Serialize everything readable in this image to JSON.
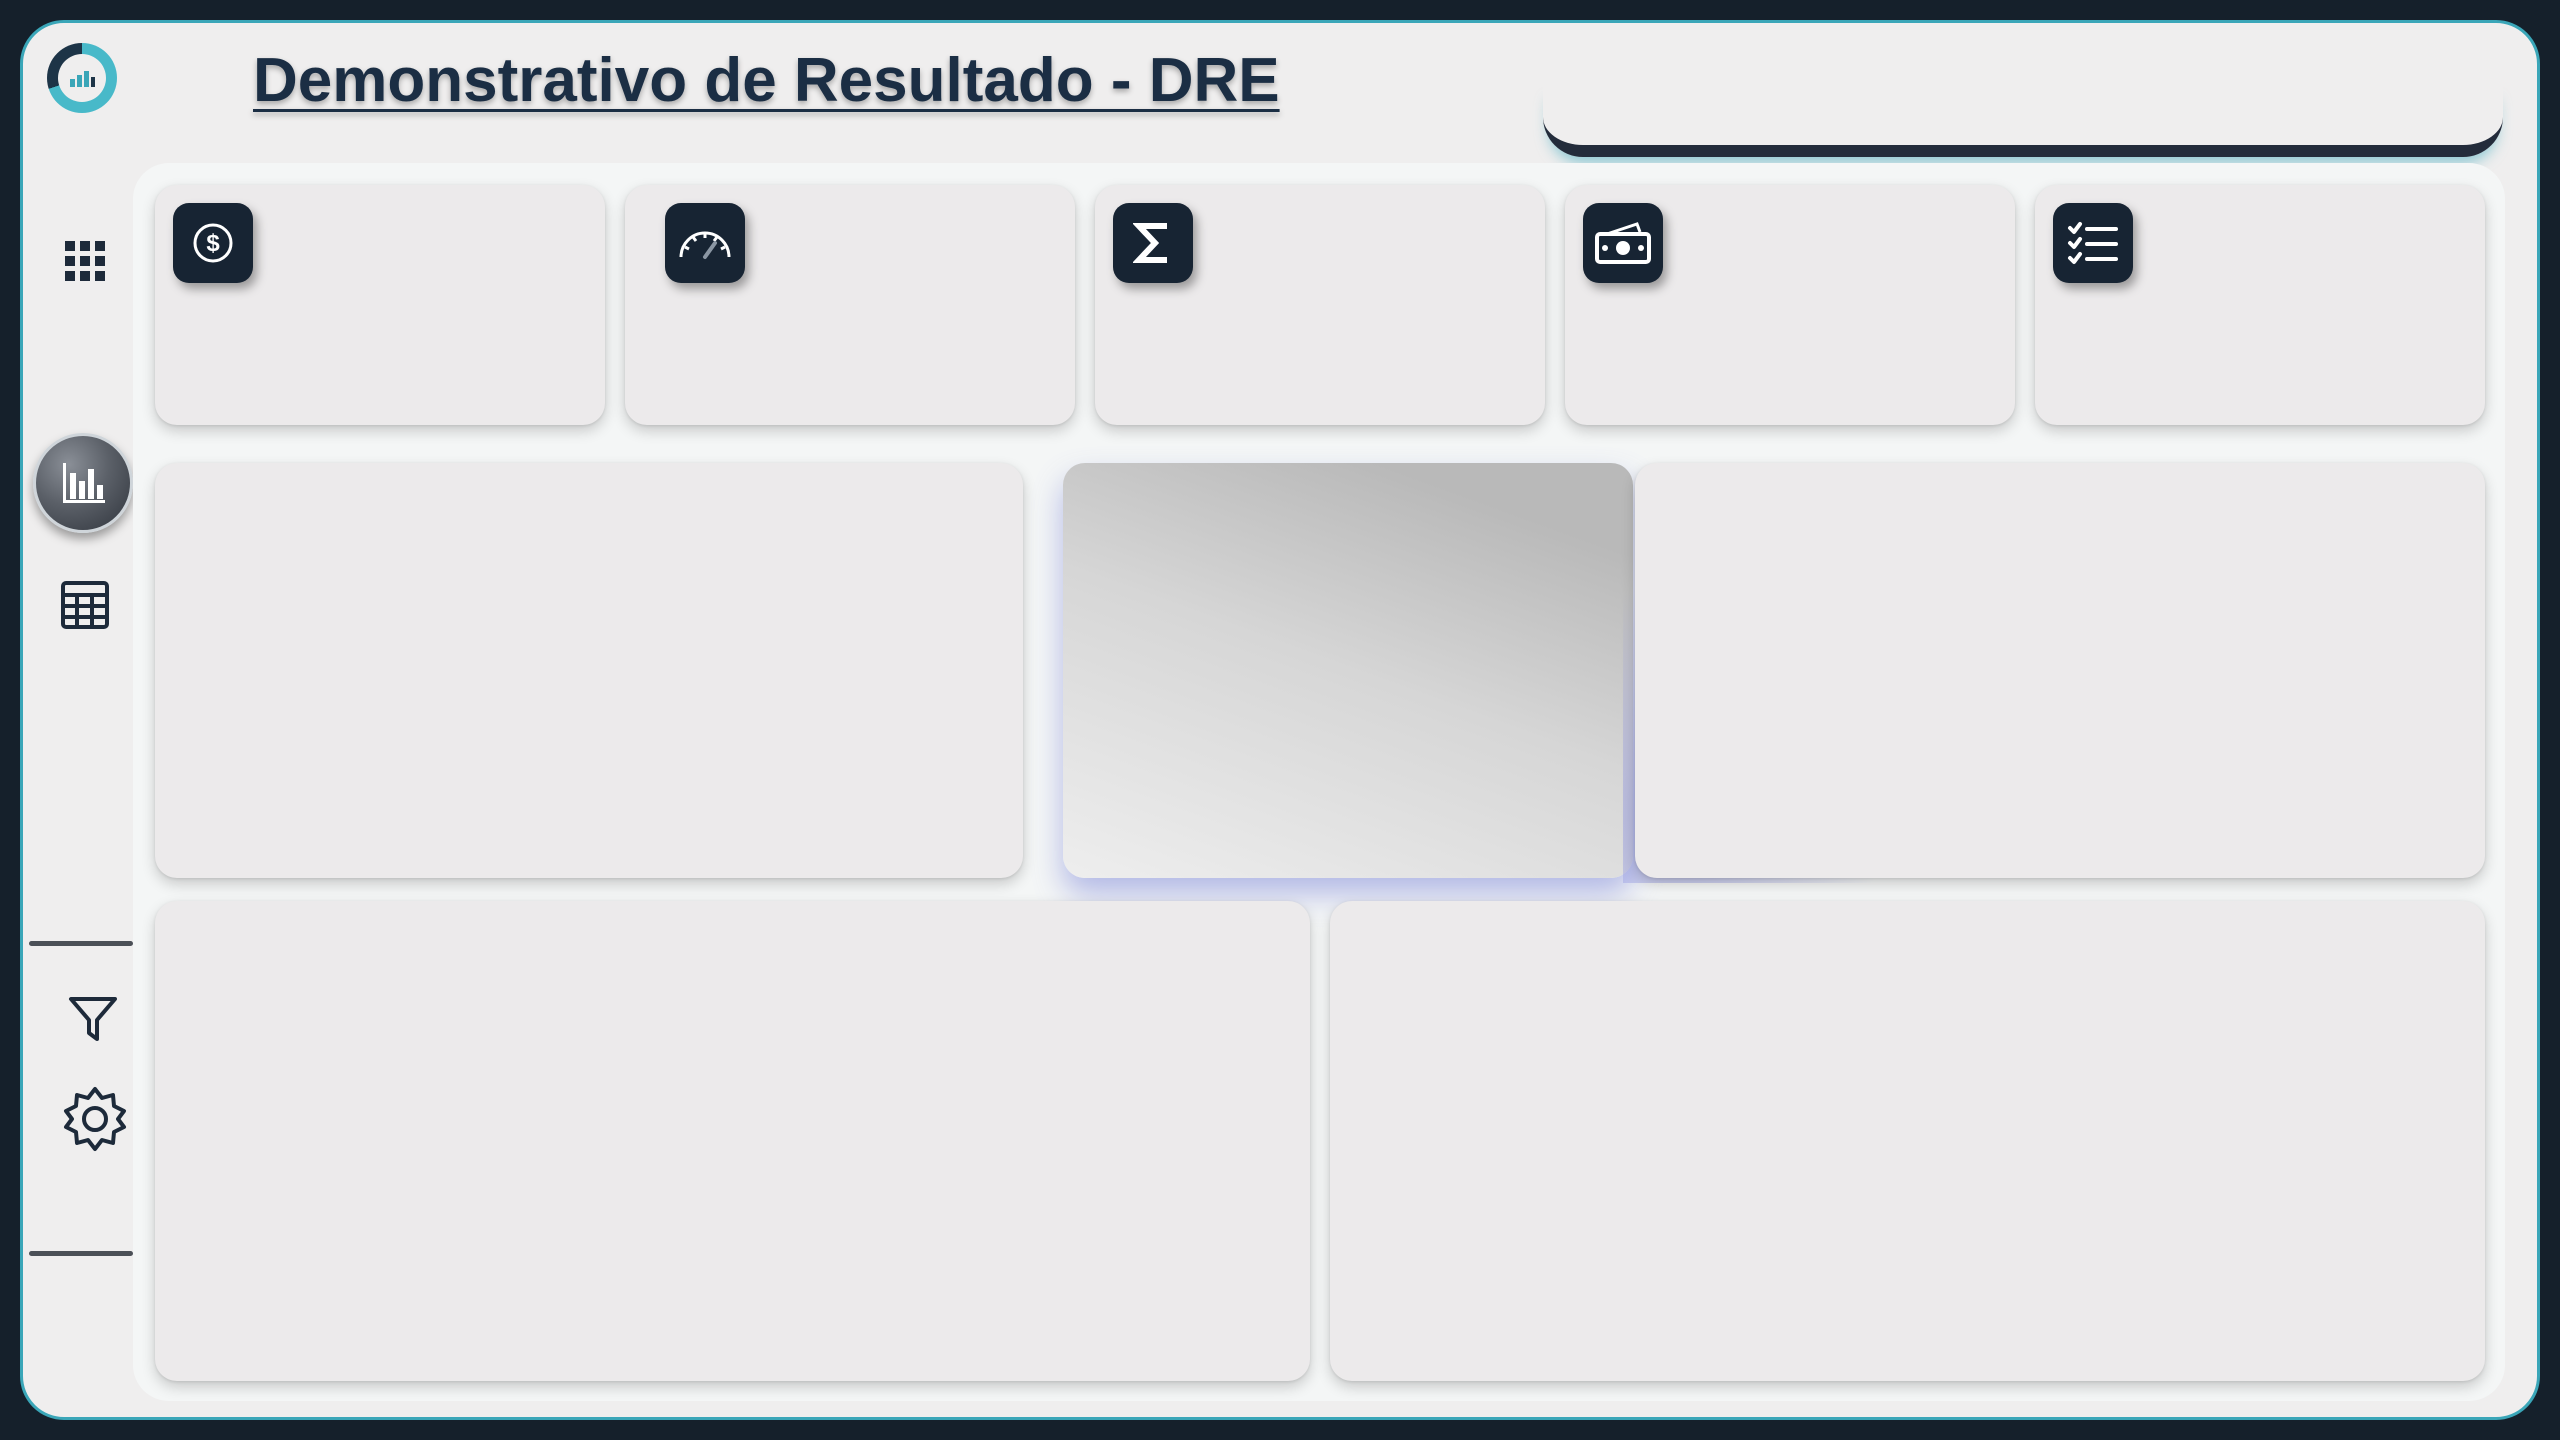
{
  "header": {
    "title": "Demonstrativo de Resultado - DRE"
  },
  "sidebar": {
    "items": [
      {
        "icon": "grid-icon",
        "active": false
      },
      {
        "icon": "bar-chart-icon",
        "active": true
      },
      {
        "icon": "table-icon",
        "active": false
      },
      {
        "icon": "filter-icon",
        "active": false
      },
      {
        "icon": "gear-icon",
        "active": false
      }
    ]
  },
  "kpi_cards": [
    {
      "icon": "dollar-circle-icon"
    },
    {
      "icon": "speedometer-icon"
    },
    {
      "icon": "sigma-icon"
    },
    {
      "icon": "money-icon"
    },
    {
      "icon": "checklist-icon"
    }
  ],
  "colors": {
    "background": "#15202b",
    "frame": "#efeeee",
    "accent": "#3aa6b8",
    "icon_tile": "#172433",
    "title": "#1b2e44"
  }
}
